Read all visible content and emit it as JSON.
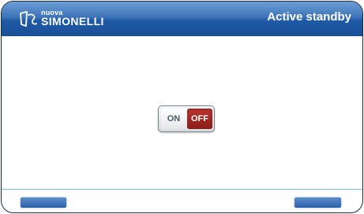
{
  "header": {
    "brand_small": "nuova",
    "brand_name": "SIMONELLI",
    "title": "Active standby"
  },
  "toggle": {
    "on_label": "ON",
    "off_label": "OFF",
    "state": "OFF"
  },
  "footer": {
    "home_label": "",
    "back_label": ""
  },
  "colors": {
    "header_blue": "#1f5aa5",
    "off_red": "#8a1d18",
    "divider_cyan": "#6fc2d6"
  },
  "icons": {
    "logo": "simonelli-logo-icon"
  }
}
